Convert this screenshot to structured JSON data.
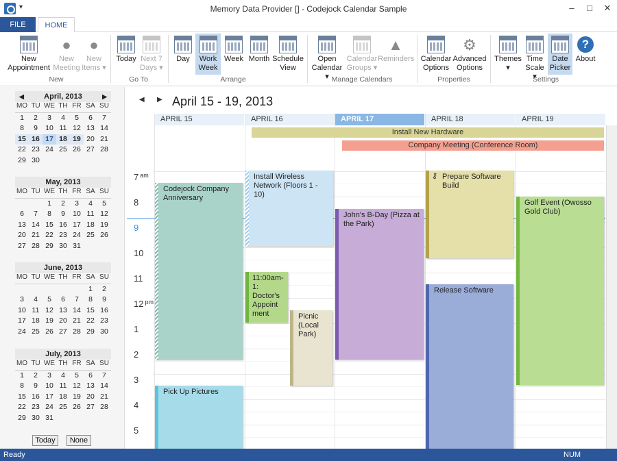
{
  "window": {
    "title": "Memory Data Provider [] - Codejock Calendar Sample",
    "quick_access": "▾",
    "min": "–",
    "max": "□",
    "close": "✕"
  },
  "tabs": {
    "file": "FILE",
    "home": "HOME"
  },
  "ribbon": {
    "new_appointment": "New\nAppointment",
    "new_meeting": "New\nMeeting",
    "new_items": "New\nItems ▾",
    "today": "Today",
    "next7": "Next 7\nDays ▾",
    "day": "Day",
    "work_week": "Work\nWeek",
    "week": "Week",
    "month": "Month",
    "schedule_view": "Schedule\nView",
    "open_calendar": "Open\nCalendar ▾",
    "calendar_groups": "Calendar\nGroups ▾",
    "reminders": "Reminders",
    "calendar_options": "Calendar\nOptions",
    "advanced_options": "Advanced\nOptions",
    "themes": "Themes\n▾",
    "time_scale": "Time\nScale ▾",
    "date_picker": "Date\nPicker",
    "about": "About",
    "about_glyph": "?",
    "groups": {
      "new": "New",
      "goto": "Go To",
      "arrange": "Arrange",
      "manage": "Manage Calendars",
      "properties": "Properties",
      "settings": "Settings"
    }
  },
  "sidebar": {
    "dow": [
      "MO",
      "TU",
      "WE",
      "TH",
      "FR",
      "SA",
      "SU"
    ],
    "prev": "◀",
    "next": "▶",
    "months": [
      {
        "title": "April, 2013",
        "days": [
          "",
          "",
          "",
          "",
          "",
          "",
          ""
        ]
      },
      {
        "title": "May, 2013"
      },
      {
        "title": "June, 2013"
      },
      {
        "title": "July, 2013"
      }
    ],
    "today_button": "Today",
    "none_button": "None"
  },
  "main": {
    "range": "April 15 - 19, 2013",
    "prev": "◀",
    "next": "▶",
    "days": [
      "APRIL 15",
      "APRIL 16",
      "APRIL 17",
      "APRIL 18",
      "APRIL 19"
    ],
    "allday": [
      {
        "title": "Install New Hardware",
        "color": "#d9d596"
      },
      {
        "title": "Company Meeting (Conference Room)",
        "color": "#f4a090"
      }
    ],
    "hours": [
      {
        "h": "7",
        "s": "am"
      },
      {
        "h": "8",
        "s": ""
      },
      {
        "h": "9",
        "s": ""
      },
      {
        "h": "10",
        "s": ""
      },
      {
        "h": "11",
        "s": ""
      },
      {
        "h": "12",
        "s": "pm"
      },
      {
        "h": "1",
        "s": ""
      },
      {
        "h": "2",
        "s": ""
      },
      {
        "h": "3",
        "s": ""
      },
      {
        "h": "4",
        "s": ""
      },
      {
        "h": "5",
        "s": ""
      }
    ],
    "events": [
      {
        "title": "Codejock Company Anniversary",
        "color": "#a9d2c9",
        "bar": "#7bbcae"
      },
      {
        "title": "Install Wireless Network (Floors 1 - 10)",
        "color": "#cde4f5",
        "bar": "#9ccbec"
      },
      {
        "title": "11:00am-1: Doctor's Appoint ment",
        "color": "#b3d88a",
        "bar": "#6fb53f"
      },
      {
        "title": "Picnic (Local Park)",
        "color": "#e8e4cf",
        "bar": "#bdb58a"
      },
      {
        "title": "John's B-Day (Pizza at the Park)",
        "color": "#c6acd6",
        "bar": "#7b5cb0"
      },
      {
        "title": "Prepare Software Build",
        "color": "#e5dfa9",
        "bar": "#b3a24b",
        "icon": "key-icon"
      },
      {
        "title": "Release Software",
        "color": "#9aadd8",
        "bar": "#4f66b0"
      },
      {
        "title": "Golf Event (Owosso Gold Club)",
        "color": "#b9dd92",
        "bar": "#72b840"
      },
      {
        "title": "Pick Up Pictures",
        "color": "#a6dcea",
        "bar": "#5cc3dc"
      }
    ]
  },
  "status": {
    "left": "Ready",
    "right": "NUM"
  }
}
